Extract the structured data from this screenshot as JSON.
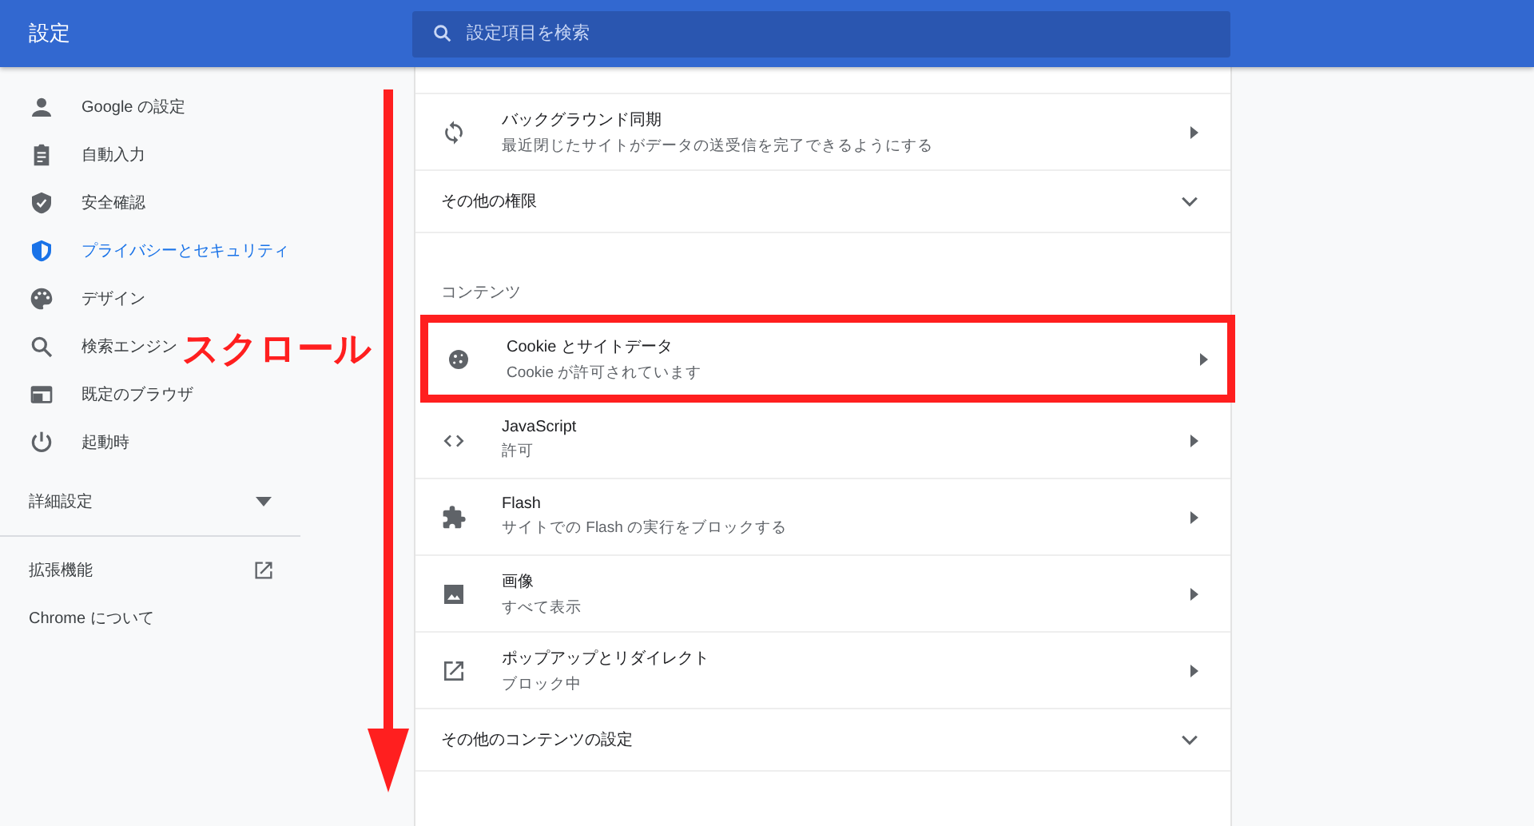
{
  "header": {
    "title": "設定",
    "search": {
      "placeholder": "設定項目を検索"
    }
  },
  "sidebar": {
    "items": [
      {
        "label": "Google の設定",
        "selected": false
      },
      {
        "label": "自動入力",
        "selected": false
      },
      {
        "label": "安全確認",
        "selected": false
      },
      {
        "label": "プライバシーとセキュリティ",
        "selected": true
      },
      {
        "label": "デザイン",
        "selected": false
      },
      {
        "label": "検索エンジン",
        "selected": false
      },
      {
        "label": "既定のブラウザ",
        "selected": false
      },
      {
        "label": "起動時",
        "selected": false
      }
    ],
    "advanced": {
      "label": "詳細設定",
      "expanded": false
    },
    "extensions": {
      "label": "拡張機能"
    },
    "about": {
      "label": "Chrome について"
    }
  },
  "main": {
    "sections": [
      {
        "rows": [
          {
            "kind": "link",
            "title": "バックグラウンド同期",
            "subtitle": "最近閉じたサイトがデータの送受信を完了できるようにする"
          },
          {
            "kind": "expand",
            "title": "その他の権限",
            "expanded": false
          }
        ]
      },
      {
        "heading": "コンテンツ",
        "rows": [
          {
            "kind": "link",
            "title": "Cookie とサイトデータ",
            "subtitle": "Cookie が許可されています",
            "highlighted": true
          },
          {
            "kind": "link",
            "title": "JavaScript",
            "subtitle": "許可"
          },
          {
            "kind": "link",
            "title": "Flash",
            "subtitle": "サイトでの Flash の実行をブロックする"
          },
          {
            "kind": "link",
            "title": "画像",
            "subtitle": "すべて表示"
          },
          {
            "kind": "link",
            "title": "ポップアップとリダイレクト",
            "subtitle": "ブロック中"
          },
          {
            "kind": "expand",
            "title": "その他のコンテンツの設定",
            "expanded": false
          }
        ]
      }
    ]
  },
  "annotation": {
    "text": "スクロール"
  }
}
